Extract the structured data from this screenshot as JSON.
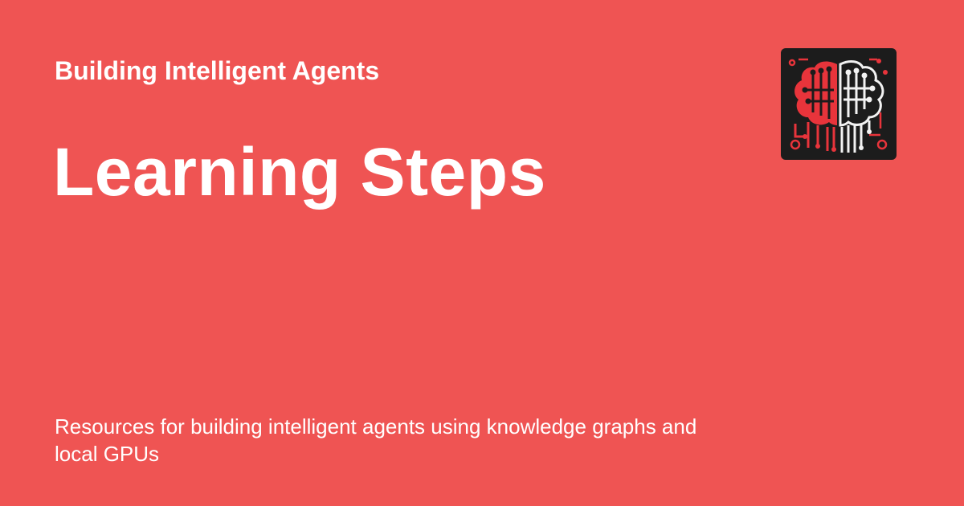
{
  "card": {
    "site_title": "Building Intelligent Agents",
    "page_title": "Learning Steps",
    "description": "Resources for building intelligent agents using knowledge graphs and local GPUs"
  },
  "logo": {
    "icon": "brain-circuit-icon"
  },
  "colors": {
    "background": "#ef5453",
    "text": "#ffffff",
    "logo_background": "#1c1c1c",
    "logo_red": "#e8343b",
    "logo_white": "#f2f2f2"
  }
}
